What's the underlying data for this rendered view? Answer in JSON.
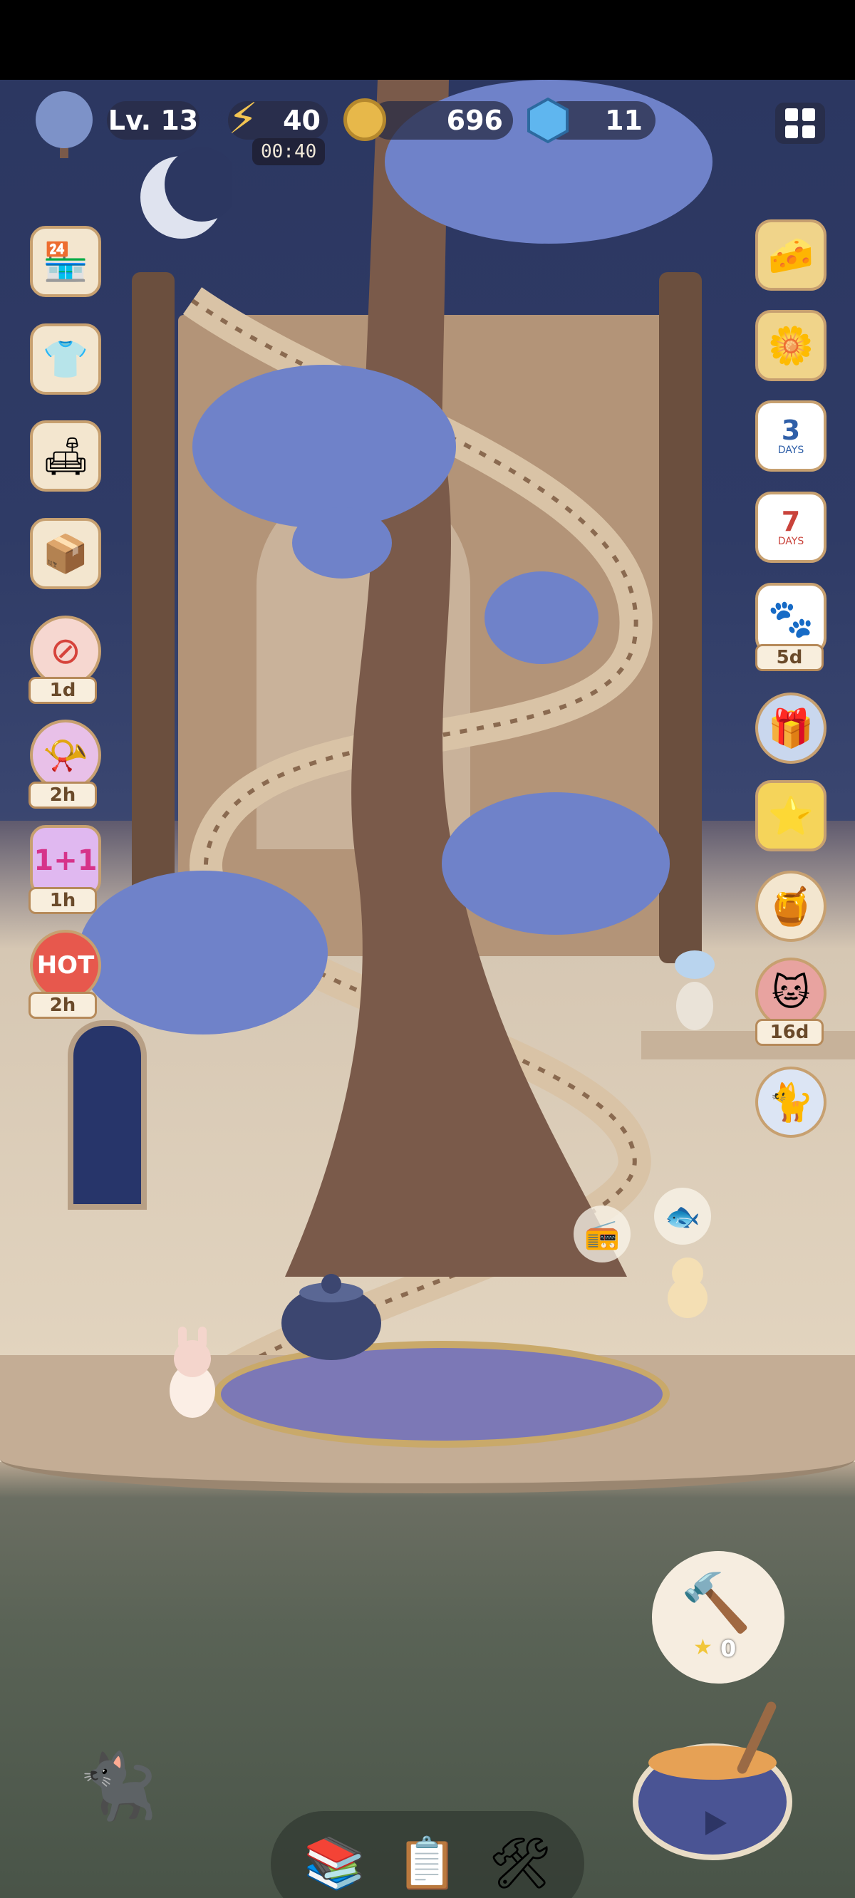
{
  "hud": {
    "level_label": "Lv. 13",
    "energy_value": "40",
    "energy_timer": "00:40",
    "coins_value": "696",
    "gems_value": "11"
  },
  "left_buttons": [
    {
      "name": "gem-shop",
      "icon": "shop-stall-icon",
      "badge": null
    },
    {
      "name": "outfit",
      "icon": "shirt-bow-icon",
      "badge": null
    },
    {
      "name": "furniture-shop",
      "icon": "sofa-icon",
      "badge": null
    },
    {
      "name": "mystery-box",
      "icon": "mystery-box-icon",
      "badge": null
    },
    {
      "name": "no-ads",
      "icon": "no-ads-icon",
      "badge": "1d"
    },
    {
      "name": "whistle-offer",
      "icon": "whistle-heart-icon",
      "badge": "2h"
    },
    {
      "name": "one-plus-one",
      "icon": "one-plus-one-icon",
      "badge": "1h"
    },
    {
      "name": "hot-deal",
      "icon": "hot-sale-icon",
      "badge": "2h"
    }
  ],
  "left_badges": {
    "b1": "1d",
    "b2": "2h",
    "b3": "1h",
    "b4": "2h",
    "hot_text": "HOT",
    "oneplus_text": "1+1"
  },
  "right_buttons": {
    "calendar3_num": "3",
    "calendar3_word": "DAYS",
    "calendar7_num": "7",
    "calendar7_word": "DAYS",
    "paw_badge": "5d",
    "cat_event_badge": "16d"
  },
  "hammer_bubble": {
    "stars": "0"
  },
  "colors": {
    "night_sky": "#2c3761",
    "tree_leaves": "#6f82c9",
    "trunk": "#7a5a4a",
    "panel_cream": "#f3e6cf"
  }
}
